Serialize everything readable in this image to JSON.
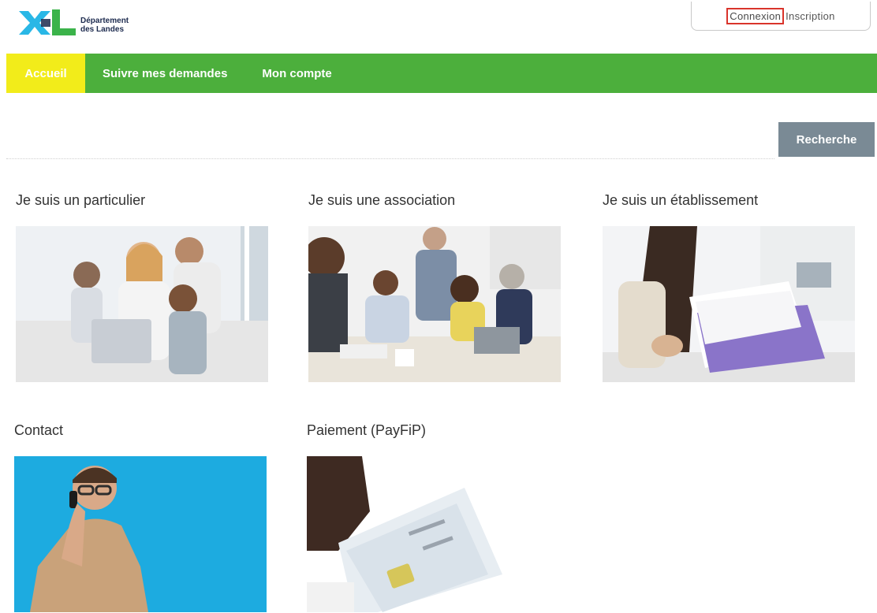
{
  "header": {
    "logo_text_line1": "Département",
    "logo_text_line2": "des Landes",
    "login_label": "Connexion",
    "register_label": "Inscription"
  },
  "nav": {
    "items": [
      {
        "label": "Accueil",
        "active": true
      },
      {
        "label": "Suivre mes demandes",
        "active": false
      },
      {
        "label": "Mon compte",
        "active": false
      }
    ]
  },
  "search": {
    "value": "",
    "placeholder": "",
    "button_label": "Recherche"
  },
  "cards": [
    {
      "title": "Je suis un particulier",
      "image": "family-with-tablet"
    },
    {
      "title": "Je suis une association",
      "image": "team-meeting"
    },
    {
      "title": "Je suis un établissement",
      "image": "person-holding-documents"
    },
    {
      "title": "Contact",
      "image": "man-on-phone"
    },
    {
      "title": "Paiement (PayFiP)",
      "image": "hand-with-credit-card"
    }
  ],
  "colors": {
    "nav_green": "#4caf3c",
    "nav_active_yellow": "#f2ec1a",
    "search_button": "#7a8a95",
    "login_highlight": "#d9342b",
    "logo_cyan": "#29b7e6",
    "logo_green": "#3bb34a"
  }
}
